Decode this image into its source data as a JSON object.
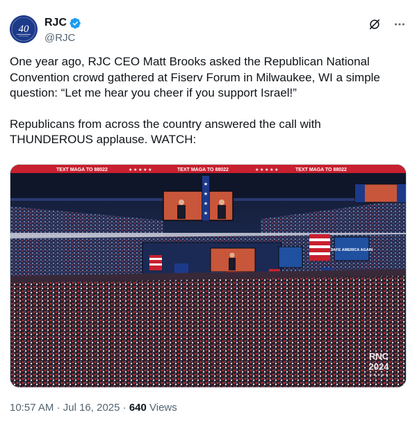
{
  "author": {
    "display_name": "RJC",
    "handle": "@RJC",
    "avatar_text": "40",
    "verified": true
  },
  "post": {
    "paragraph_1": "One year ago, RJC CEO Matt Brooks asked the Republican National Convention crowd gathered at Fiserv Forum in Milwaukee, WI a simple question: “Let me hear you cheer if you support Israel!”",
    "paragraph_2": "Republicans from across the country answered the call with THUNDEROUS applause. WATCH:"
  },
  "media": {
    "type": "video",
    "banner_texts": [
      "TEXT MAGA TO 88022",
      "TEXT MAGA TO 88022",
      "TEXT MAGA TO 88022"
    ],
    "banner_highlight": "MAGA",
    "screen_text": "SAFE AMERICA AGAIN",
    "watermark_line1": "RNC",
    "watermark_line2": "2024"
  },
  "meta": {
    "time": "10:57 AM",
    "date": "Jul 16, 2025",
    "views_count": "640",
    "views_label": "Views",
    "separator": "·"
  },
  "icons": {
    "verified": "verified-badge-icon",
    "grok": "grok-icon",
    "more": "more-icon"
  },
  "colors": {
    "verified": "#1d9bf0",
    "secondary_text": "#536471",
    "primary_text": "#0f1419",
    "banner_red": "#c8202f"
  }
}
